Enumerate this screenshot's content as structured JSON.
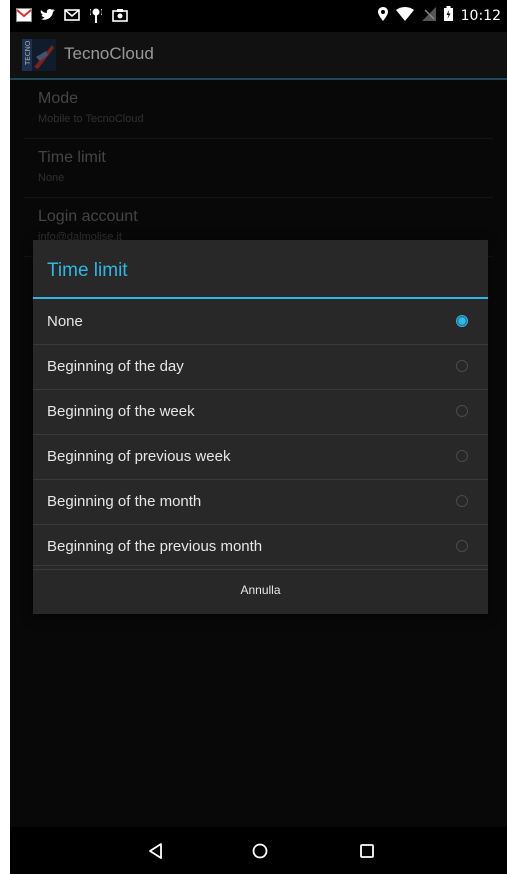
{
  "statusbar": {
    "left_icons": [
      "gmail-icon",
      "twitter-icon",
      "mail-icon",
      "wifi-tower-icon",
      "camera-icon"
    ],
    "right_icons": [
      "location-icon",
      "wifi-icon",
      "no-signal-icon",
      "battery-icon"
    ],
    "time": "10:12"
  },
  "appbar": {
    "title": "TecnoCloud",
    "icon": "tecnocloud-logo"
  },
  "preferences": [
    {
      "title": "Mode",
      "summary": "Mobile to TecnoCloud"
    },
    {
      "title": "Time limit",
      "summary": "None"
    },
    {
      "title": "Login account",
      "summary": "info@dalmolise.it"
    }
  ],
  "dialog": {
    "title": "Time limit",
    "options": [
      {
        "label": "None",
        "selected": true
      },
      {
        "label": "Beginning of the day",
        "selected": false
      },
      {
        "label": "Beginning of the week",
        "selected": false
      },
      {
        "label": "Beginning of previous week",
        "selected": false
      },
      {
        "label": "Beginning of the month",
        "selected": false
      },
      {
        "label": "Beginning of the previous month",
        "selected": false
      }
    ],
    "cancel_label": "Annulla"
  },
  "navbar": {
    "back": "back-icon",
    "home": "home-icon",
    "recents": "recents-icon"
  },
  "colors": {
    "accent": "#33b5e5",
    "dialog_bg": "#282828",
    "screen_bg": "#0d0d0d"
  }
}
